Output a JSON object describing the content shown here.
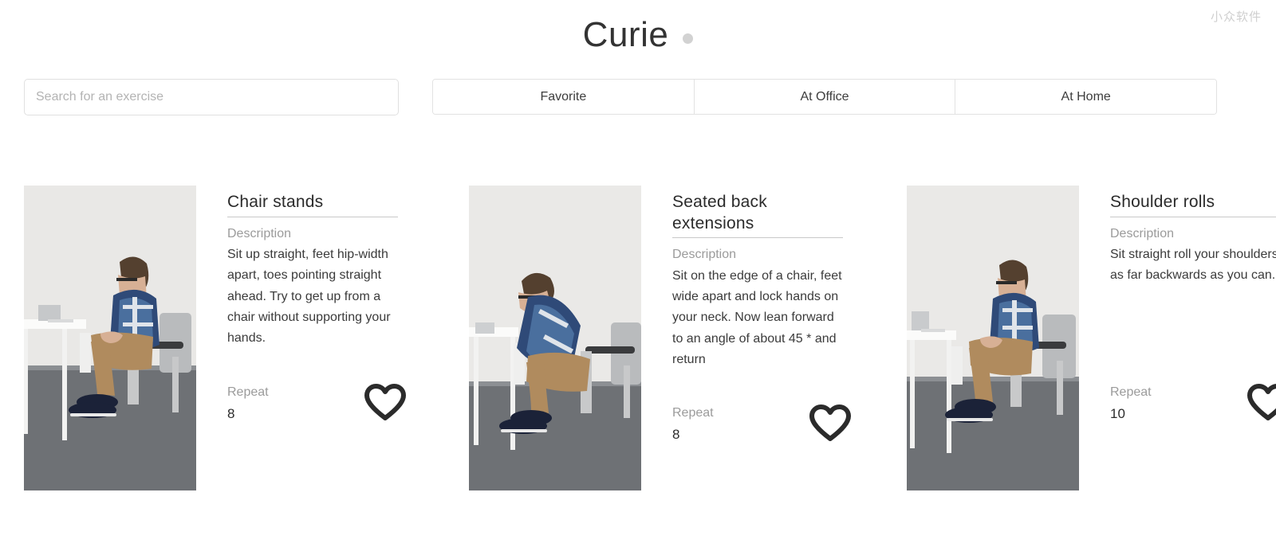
{
  "header": {
    "title": "Curie",
    "status_dot_color": "#d2d2d2",
    "watermark": "小众软件"
  },
  "search": {
    "value": "",
    "placeholder": "Search for an exercise"
  },
  "tabs": [
    {
      "label": "Favorite"
    },
    {
      "label": "At Office"
    },
    {
      "label": "At Home"
    }
  ],
  "labels": {
    "description": "Description",
    "repeat": "Repeat",
    "favorite_icon": "heart-outline-icon"
  },
  "exercises": [
    {
      "title": "Chair stands",
      "description": "Sit up straight, feet hip-width apart, toes pointing straight ahead. Try to get up from a chair without supporting your hands.",
      "repeat": "8",
      "favorited": false,
      "photo_alt": "man-sitting-upright-on-office-chair"
    },
    {
      "title": "Seated back extensions",
      "description": "Sit on the edge of a chair, feet wide apart and lock hands on your neck. Now lean forward to an angle of about 45 * and return",
      "repeat": "8",
      "favorited": false,
      "photo_alt": "man-leaning-forward-on-office-chair"
    },
    {
      "title": "Shoulder rolls",
      "description": "Sit straight roll your shoulders as far backwards as you can.",
      "repeat": "10",
      "favorited": false,
      "photo_alt": "man-sitting-straight-rolling-shoulders"
    }
  ]
}
